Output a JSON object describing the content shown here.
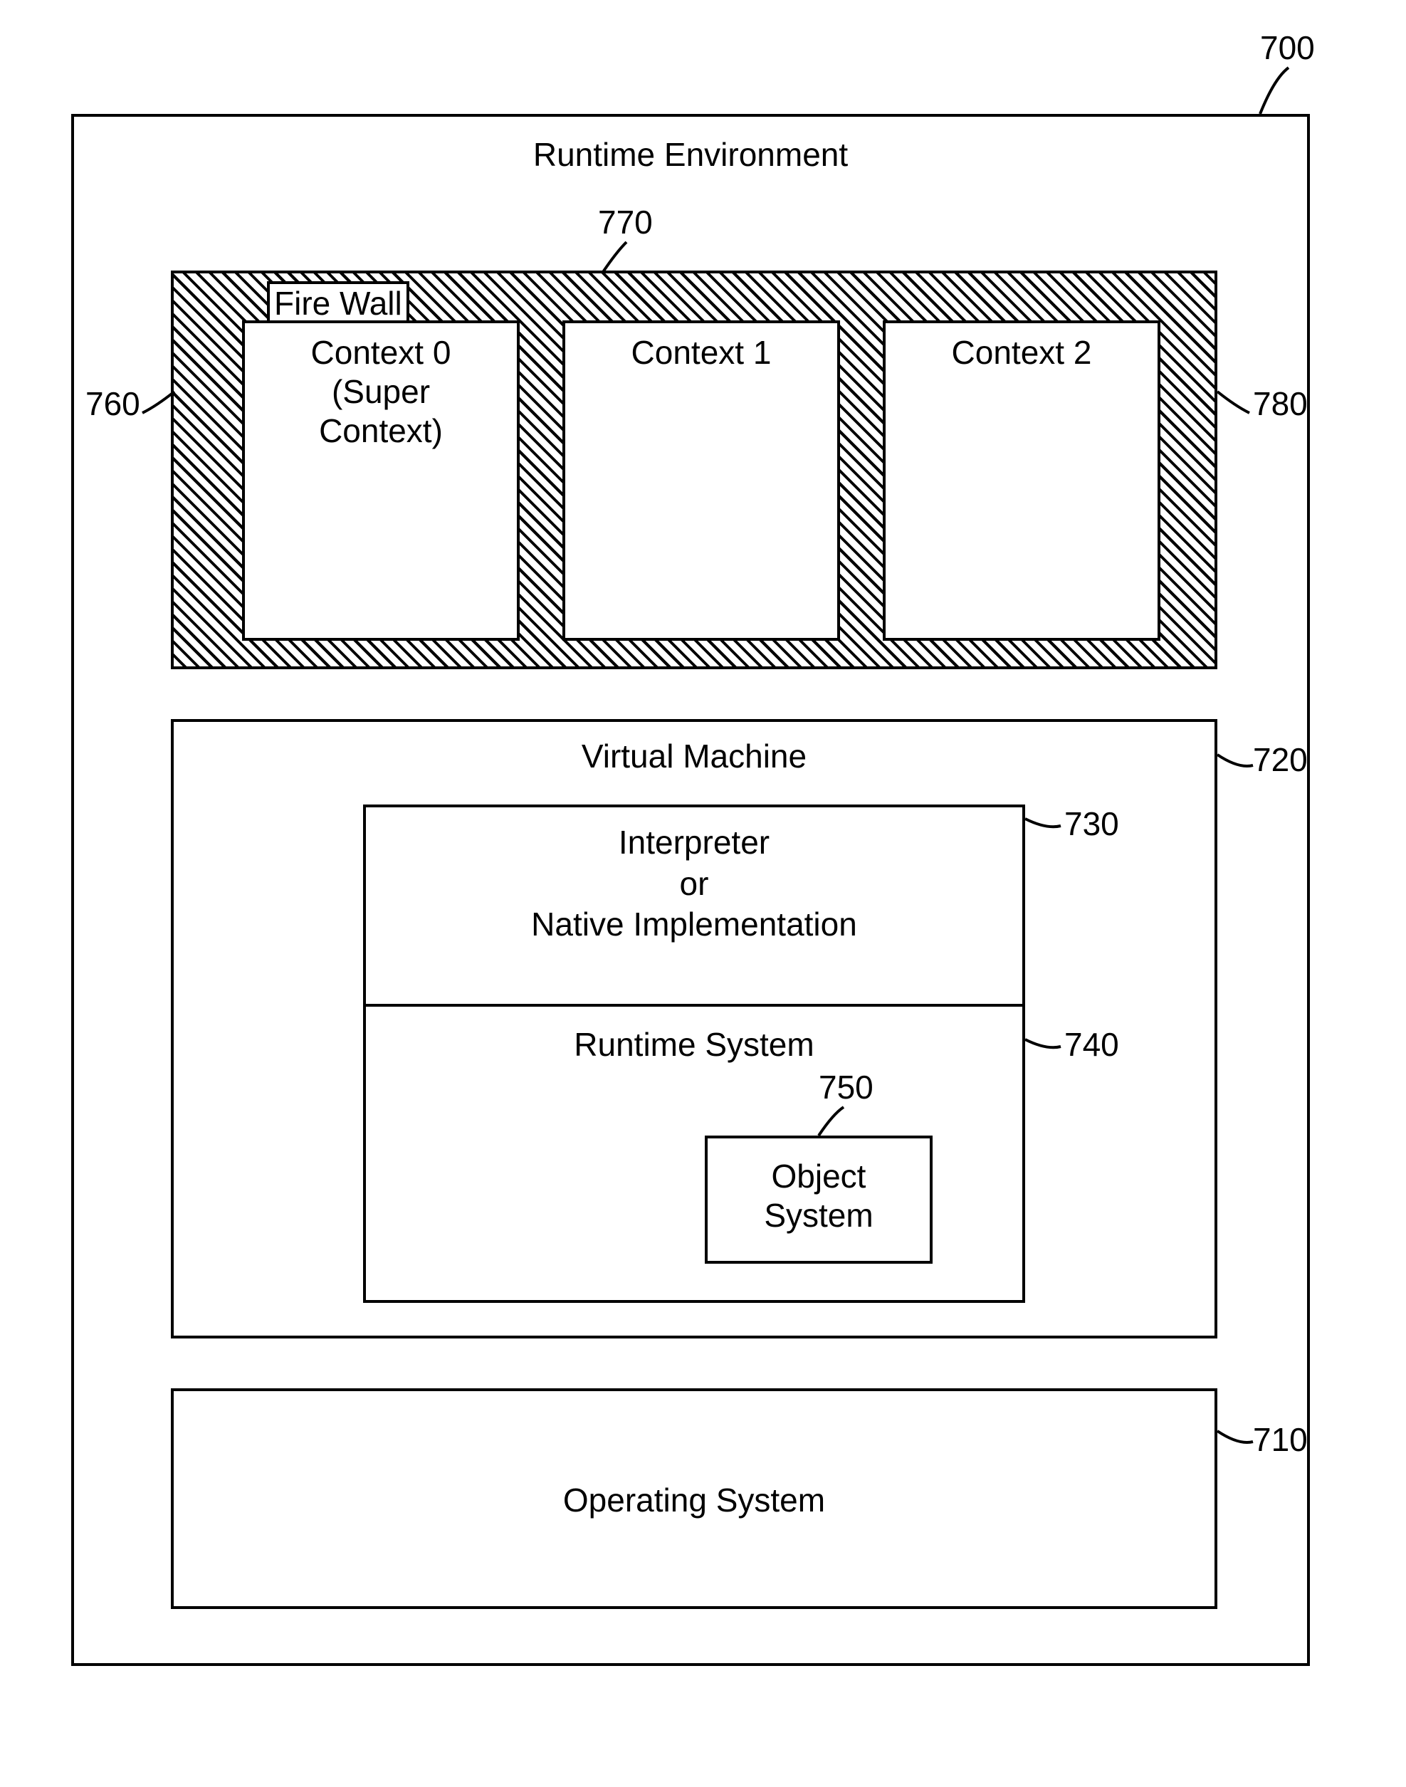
{
  "title": "Runtime Environment",
  "ref_main": "700",
  "firewall_label": "Fire Wall",
  "contexts": [
    {
      "line1": "Context 0",
      "line2": "(Super",
      "line3": "Context)",
      "ref": "760"
    },
    {
      "line1": "Context 1",
      "line2": "",
      "line3": "",
      "ref": "770"
    },
    {
      "line1": "Context 2",
      "line2": "",
      "line3": "",
      "ref": "780"
    }
  ],
  "vm": {
    "title": "Virtual Machine",
    "ref": "720",
    "interpreter_l1": "Interpreter",
    "interpreter_l2": "or",
    "interpreter_l3": "Native Implementation",
    "interpreter_ref": "730",
    "runtime_system": "Runtime System",
    "runtime_ref": "740",
    "object_l1": "Object",
    "object_l2": "System",
    "object_ref": "750"
  },
  "os": {
    "title": "Operating System",
    "ref": "710"
  }
}
